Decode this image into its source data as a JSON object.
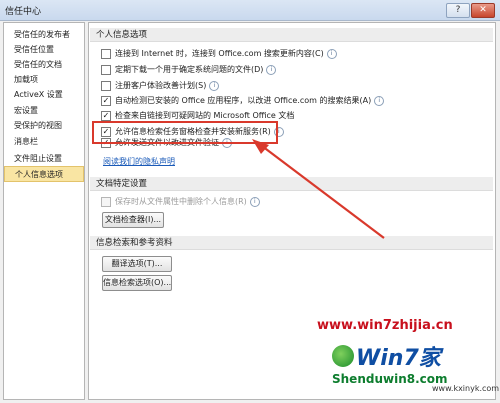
{
  "window": {
    "title": "信任中心",
    "help_glyph": "?",
    "close_glyph": "✕"
  },
  "sidebar": {
    "items": [
      {
        "label": "受信任的发布者"
      },
      {
        "label": "受信任位置"
      },
      {
        "label": "受信任的文档"
      },
      {
        "label": "加载项"
      },
      {
        "label": "ActiveX 设置"
      },
      {
        "label": "宏设置"
      },
      {
        "label": "受保护的视图"
      },
      {
        "label": "消息栏"
      },
      {
        "label": "文件阻止设置"
      },
      {
        "label": "个人信息选项",
        "selected": true
      }
    ]
  },
  "personal": {
    "heading": "个人信息选项",
    "options": [
      {
        "label": "连接到 Internet 时，连接到 Office.com 搜索更新内容(C)",
        "checked": false
      },
      {
        "label": "定期下载一个用于确定系统问题的文件(D)",
        "checked": false
      },
      {
        "label": "注册客户体验改善计划(S)",
        "checked": false
      },
      {
        "label": "自动检测已安装的 Office 应用程序，以改进 Office.com 的搜索结果(A)",
        "checked": true
      },
      {
        "label": "检查来自链接到可疑网站的 Microsoft Office 文档",
        "checked": true
      },
      {
        "label": "允许信息检索任务窗格检查并安装新服务(R)",
        "checked": true
      },
      {
        "label": "允许发送文件以改进文件验证",
        "checked": true
      }
    ],
    "privacy_link": "阅读我们的隐私声明",
    "info_glyph": "i"
  },
  "document": {
    "heading": "文档特定设置",
    "option": {
      "label": "保存时从文件属性中删除个人信息(R)",
      "checked": false,
      "disabled": true
    },
    "inspector_button": "文档检查器(I)..."
  },
  "research": {
    "heading": "信息检索和参考资料",
    "translate_button": "翻译选项(T)...",
    "research_button": "信息检索选项(O)..."
  },
  "check_glyph": "✓",
  "highlight_color": "#d9392c",
  "watermark": {
    "url": "www.win7zhijia.cn",
    "logo_text": "Win7家",
    "site": "Shenduwin8.com",
    "site2": "www.kxinyk.com"
  }
}
